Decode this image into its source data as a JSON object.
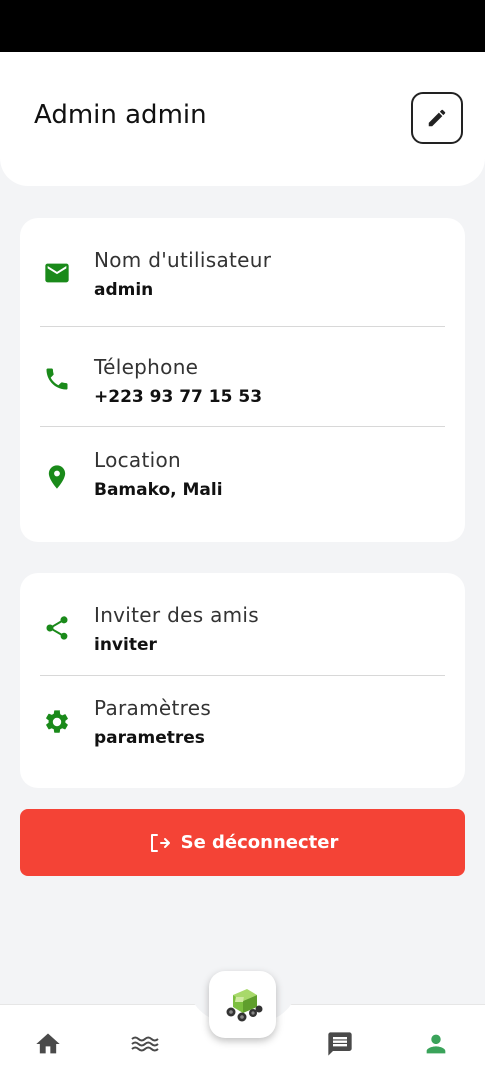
{
  "header": {
    "user_name": "Admin admin"
  },
  "info_card": {
    "username": {
      "label": "Nom d'utilisateur",
      "value": "admin"
    },
    "phone": {
      "label": "Télephone",
      "value": "+223 93 77 15 53"
    },
    "location": {
      "label": "Location",
      "value": "Bamako, Mali"
    }
  },
  "actions_card": {
    "invite": {
      "label": "Inviter des amis",
      "value": "inviter"
    },
    "settings": {
      "label": "Paramètres",
      "value": "parametres"
    }
  },
  "logout": {
    "label": "Se déconnecter"
  },
  "colors": {
    "accent": "#1a8a1a",
    "danger": "#f44336",
    "nav_active": "#3aa35a",
    "nav_inactive": "#4a4a4a"
  },
  "bottom_nav": {
    "items": [
      {
        "icon": "home-icon"
      },
      {
        "icon": "waves-icon"
      },
      {
        "icon": "tractor-icon"
      },
      {
        "icon": "chat-icon"
      },
      {
        "icon": "person-icon"
      }
    ]
  }
}
